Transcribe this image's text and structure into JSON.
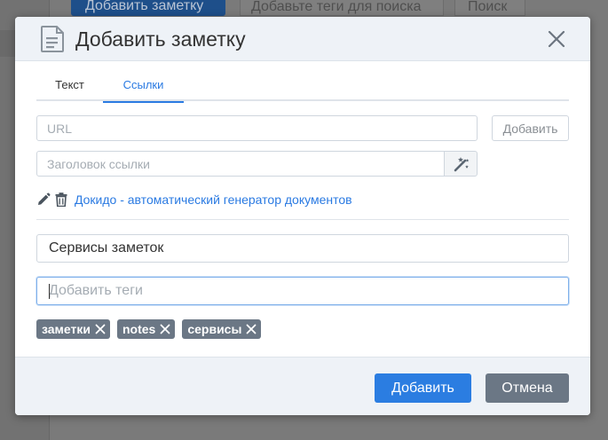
{
  "background": {
    "add_note_button": "Добавить заметку",
    "tags_search_placeholder": "Добавьте теги для поиска",
    "search_button": "Поиск"
  },
  "modal": {
    "title": "Добавить заметку",
    "icon": "document-icon",
    "close_icon": "close-icon"
  },
  "tabs": [
    {
      "label": "Текст",
      "active": false
    },
    {
      "label": "Ссылки",
      "active": true
    }
  ],
  "links_form": {
    "url_placeholder": "URL",
    "url_value": "",
    "add_button": "Добавить",
    "title_placeholder": "Заголовок ссылки",
    "title_value": "",
    "magic_icon": "magic-wand-icon"
  },
  "link_item": {
    "text": "Докидо - автоматический генератор документов",
    "edit_icon": "pencil-icon",
    "delete_icon": "trash-icon"
  },
  "note_name": {
    "value": "Сервисы заметок"
  },
  "tags_input": {
    "placeholder": "Добавить теги",
    "value": ""
  },
  "tags": [
    "заметки",
    "notes",
    "сервисы"
  ],
  "footer": {
    "submit_button": "Добавить",
    "cancel_button": "Отмена"
  },
  "colors": {
    "primary": "#2b7de1",
    "link": "#2a7ae2",
    "tag": "#6b7785",
    "header_bg": "#eef2f7"
  }
}
